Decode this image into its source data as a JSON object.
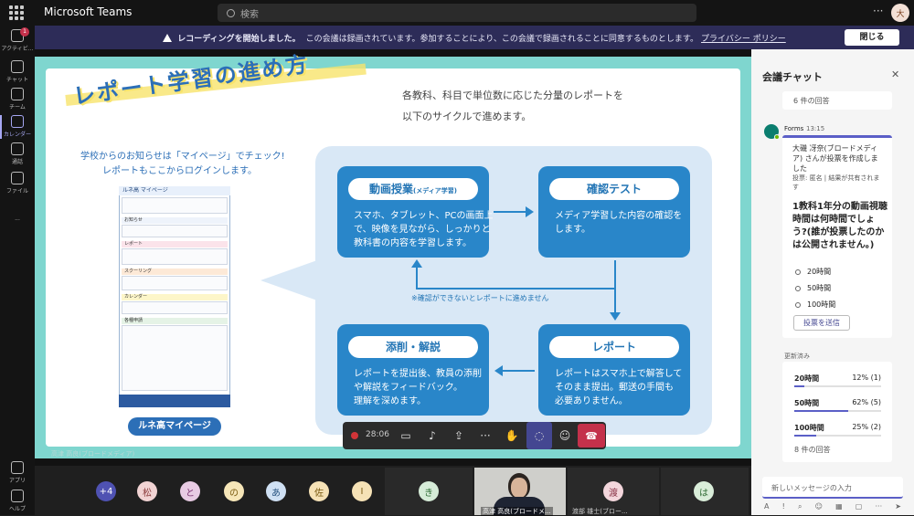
{
  "app": {
    "name": "Microsoft Teams",
    "search_placeholder": "検索",
    "more": "···",
    "avatar_initial": "大"
  },
  "rail": [
    {
      "label": "アクティビ...",
      "badge": "1"
    },
    {
      "label": "チャット"
    },
    {
      "label": "チーム"
    },
    {
      "label": "カレンダー",
      "active": true
    },
    {
      "label": "通話"
    },
    {
      "label": "ファイル"
    },
    {
      "label": "···"
    },
    {
      "label": "アプリ"
    },
    {
      "label": "ヘルプ"
    }
  ],
  "banner": {
    "bold": "レコーディングを開始しました。",
    "text": "この会議は録画されています。参加することにより、この会議で録画されることに同意するものとします。",
    "link": "プライバシー ポリシー",
    "close": "閉じる"
  },
  "slide": {
    "title": "レポート学習の進め方",
    "intro_line1": "各教科、科目で単位数に応じた分量のレポートを",
    "intro_line2": "以下のサイクルで進めます。",
    "notice_line1": "学校からのお知らせは「マイページ」でチェック!",
    "notice_line2": "レポートもここからログインします。",
    "mypage_header": "ルネ高 マイページ",
    "mypage_sections": [
      "お知らせ",
      "レポート",
      "スクーリング",
      "カレンダー",
      "各種申請"
    ],
    "mypage_button": "ルネ高マイページ",
    "cards": [
      {
        "title": "動画授業",
        "subtitle": "(メディア学習)",
        "text": [
          "スマホ、タブレット、PCの画面上",
          "で、映像を見ながら、しっかりと",
          "教科書の内容を学習します。"
        ]
      },
      {
        "title": "確認テスト",
        "subtitle": "",
        "text": [
          "メディア学習した内容の確認を",
          "します。"
        ]
      },
      {
        "title": "レポート",
        "subtitle": "",
        "text": [
          "レポートはスマホ上で解答して",
          "そのまま提出。郵送の手間も",
          "必要ありません。"
        ]
      },
      {
        "title": "添削・解説",
        "subtitle": "",
        "text": [
          "レポートを提出後、教員の添削",
          "や解説をフィードバック。",
          "理解を深めます。"
        ]
      }
    ],
    "cycle_note": "※確認ができないとレポートに進めません",
    "presenter_caption": "高津 高良(ブロードメディア)"
  },
  "controls": {
    "timer": "28:06"
  },
  "participants": [
    {
      "label": "+4",
      "bg": "#4f52b2",
      "fg": "#ffffff"
    },
    {
      "label": "松",
      "bg": "#f1d3d3",
      "fg": "#8a3a3a"
    },
    {
      "label": "と",
      "bg": "#e8cbe3",
      "fg": "#7a2f6e"
    },
    {
      "label": "の",
      "bg": "#f6e6b8",
      "fg": "#7a5b10"
    },
    {
      "label": "あ",
      "bg": "#cfe0f3",
      "fg": "#24507e"
    },
    {
      "label": "佐",
      "bg": "#f6e2b6",
      "fg": "#7a5a10"
    },
    {
      "label": "I",
      "bg": "#f6e2b6",
      "fg": "#7a5a10"
    },
    {
      "label": "き",
      "bg": "#d6ecd8",
      "fg": "#2c6b32"
    },
    {
      "label": "渡",
      "bg": "#f3d6dc",
      "fg": "#8a3347"
    },
    {
      "label": "は",
      "bg": "#d9edd9",
      "fg": "#2f6b33"
    }
  ],
  "video_name": "高津 高良(ブロードメ...",
  "tile_name": "渡部 雄士(ブロー...",
  "chat": {
    "title": "会議チャット",
    "prev_count": "6 件の回答",
    "sender": "Forms",
    "time": "13:15",
    "meta1": "大磯 冴奈(ブロードメディア) さんが投票を作成しました",
    "meta2": "投票: 匿名 | 結果が共有されます",
    "question": "1教科1年分の動画視聴時間は何時間でしょう?(誰が投票したのかは公開されません。)",
    "options": [
      "20時間",
      "50時間",
      "100時間"
    ],
    "submit": "投票を送信",
    "updated": "更新済み",
    "results": [
      {
        "label": "20時間",
        "percent": 12,
        "count": "12% (1)"
      },
      {
        "label": "50時間",
        "percent": 62,
        "count": "62% (5)"
      },
      {
        "label": "100時間",
        "percent": 25,
        "count": "25% (2)"
      }
    ],
    "result_total": "8 件の回答",
    "input_placeholder": "新しいメッセージの入力"
  }
}
